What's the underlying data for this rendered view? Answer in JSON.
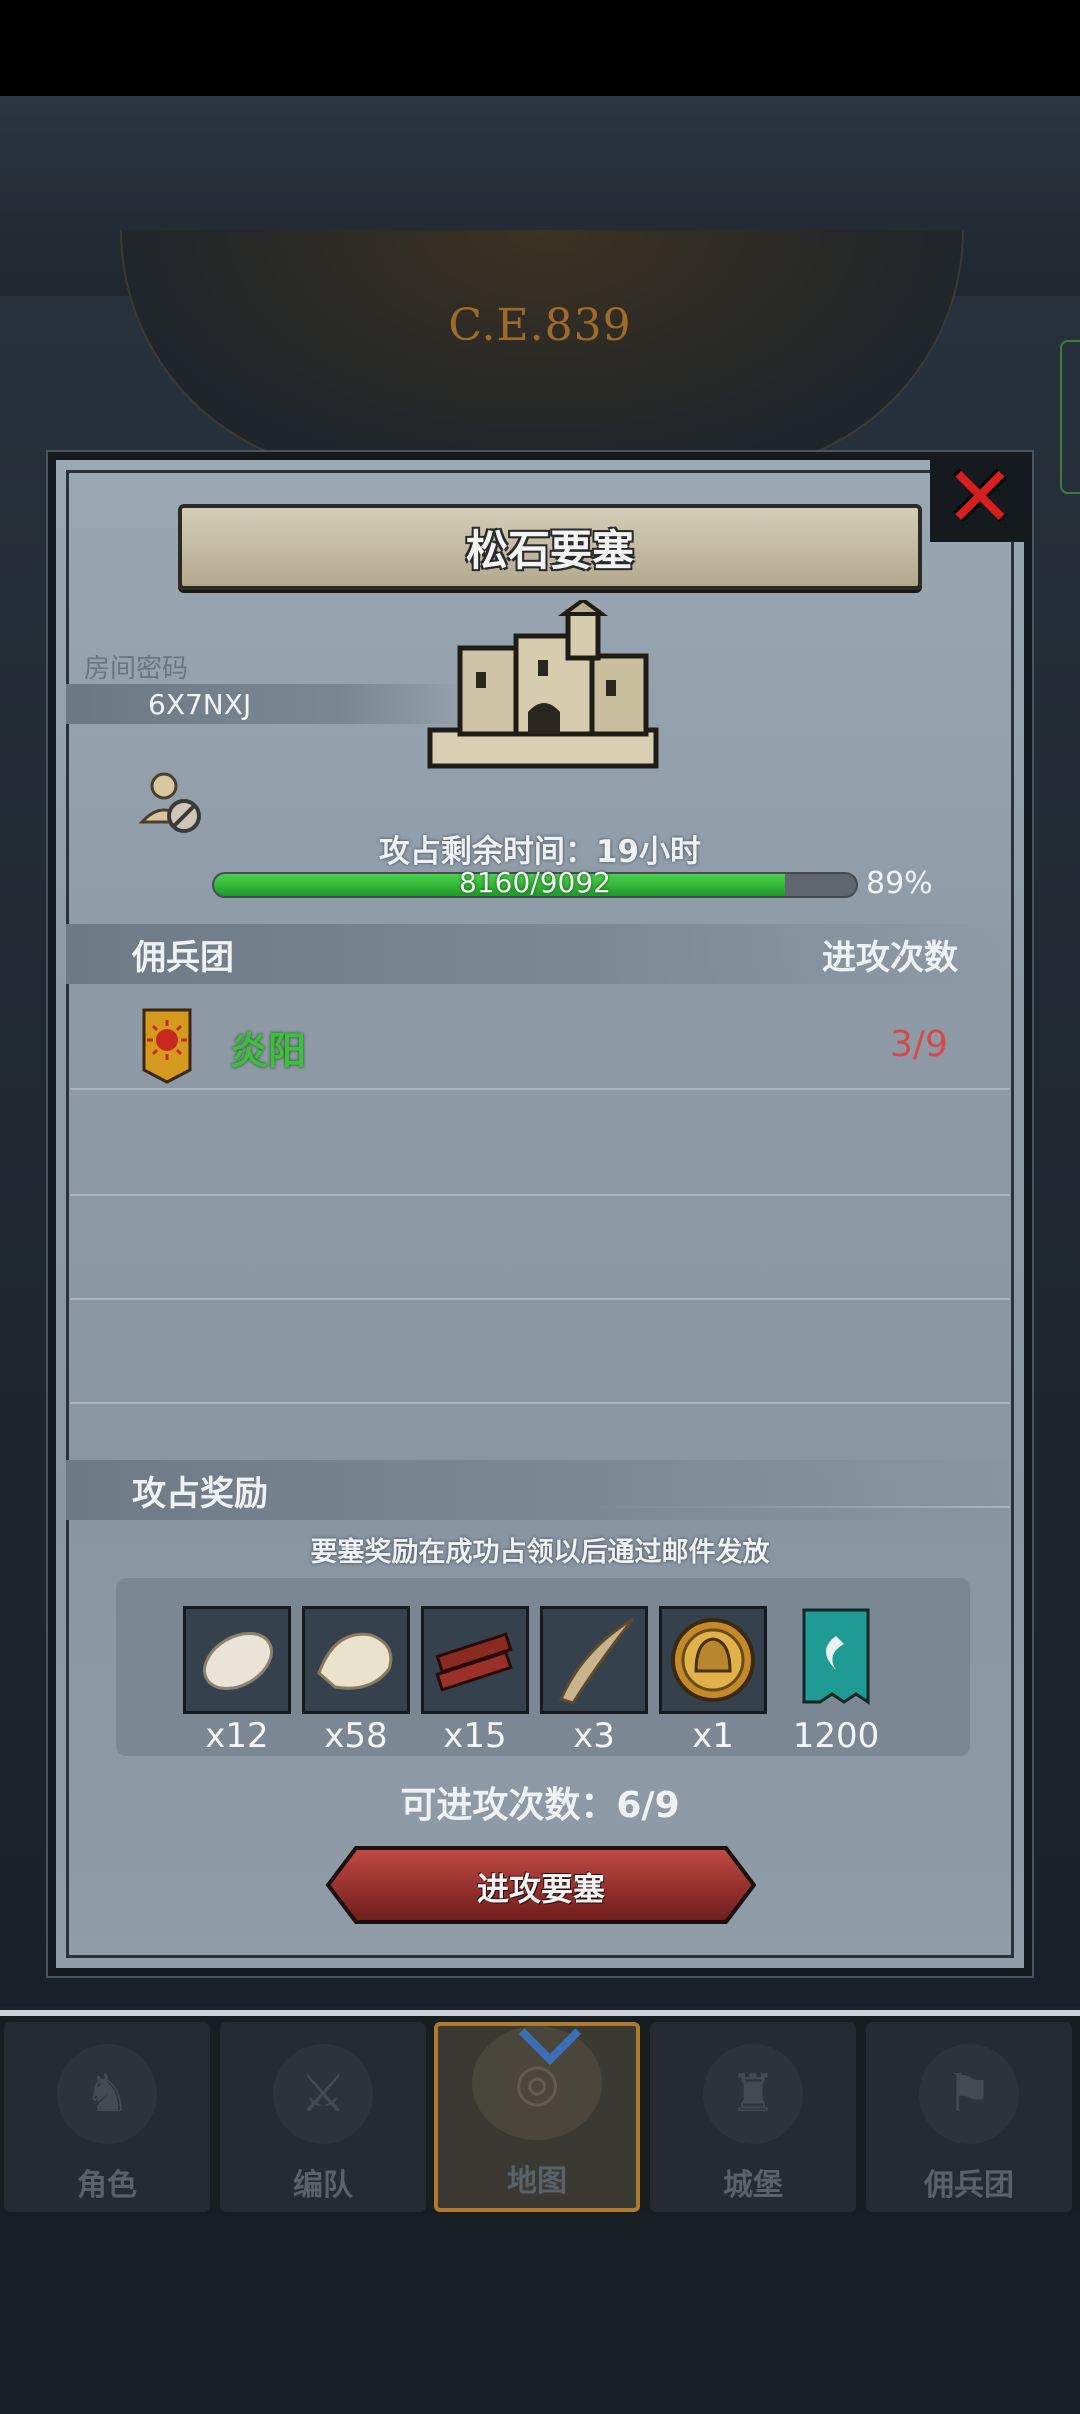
{
  "era": "C.E.839",
  "dialog": {
    "title": "松石要塞",
    "room_password_label": "房间密码",
    "room_password_value": "6X7NXJ",
    "siege_time_label": "攻占剩余时间：19小时",
    "progress": {
      "text": "8160/9092",
      "percent_label": "89%",
      "fraction": 0.89
    }
  },
  "mercenary_section": {
    "title": "佣兵团",
    "right_label": "进攻次数",
    "rows": [
      {
        "name": "炎阳",
        "count": "3/9"
      }
    ]
  },
  "reward_section": {
    "title": "攻占奖励",
    "note": "要塞奖励在成功占领以后通过邮件发放",
    "items": [
      {
        "icon": "white-fur-icon",
        "qty": "x12"
      },
      {
        "icon": "pelt-icon",
        "qty": "x58"
      },
      {
        "icon": "wood-planks-icon",
        "qty": "x15"
      },
      {
        "icon": "horn-icon",
        "qty": "x3"
      },
      {
        "icon": "golden-helmet-badge-icon",
        "qty": "x1"
      },
      {
        "icon": "teal-banner-icon",
        "qty": "1200"
      }
    ]
  },
  "attack_count": "可进攻次数：6/9",
  "attack_button": "进攻要塞",
  "nav": [
    {
      "label": "角色",
      "icon": "knight-icon"
    },
    {
      "label": "编队",
      "icon": "formation-icon"
    },
    {
      "label": "地图",
      "icon": "map-icon",
      "active": true
    },
    {
      "label": "城堡",
      "icon": "castle-icon"
    },
    {
      "label": "佣兵团",
      "icon": "mercenary-icon"
    }
  ],
  "colors": {
    "green": "#39c23a",
    "red": "#d44a4a",
    "accent": "#b07a2c"
  }
}
